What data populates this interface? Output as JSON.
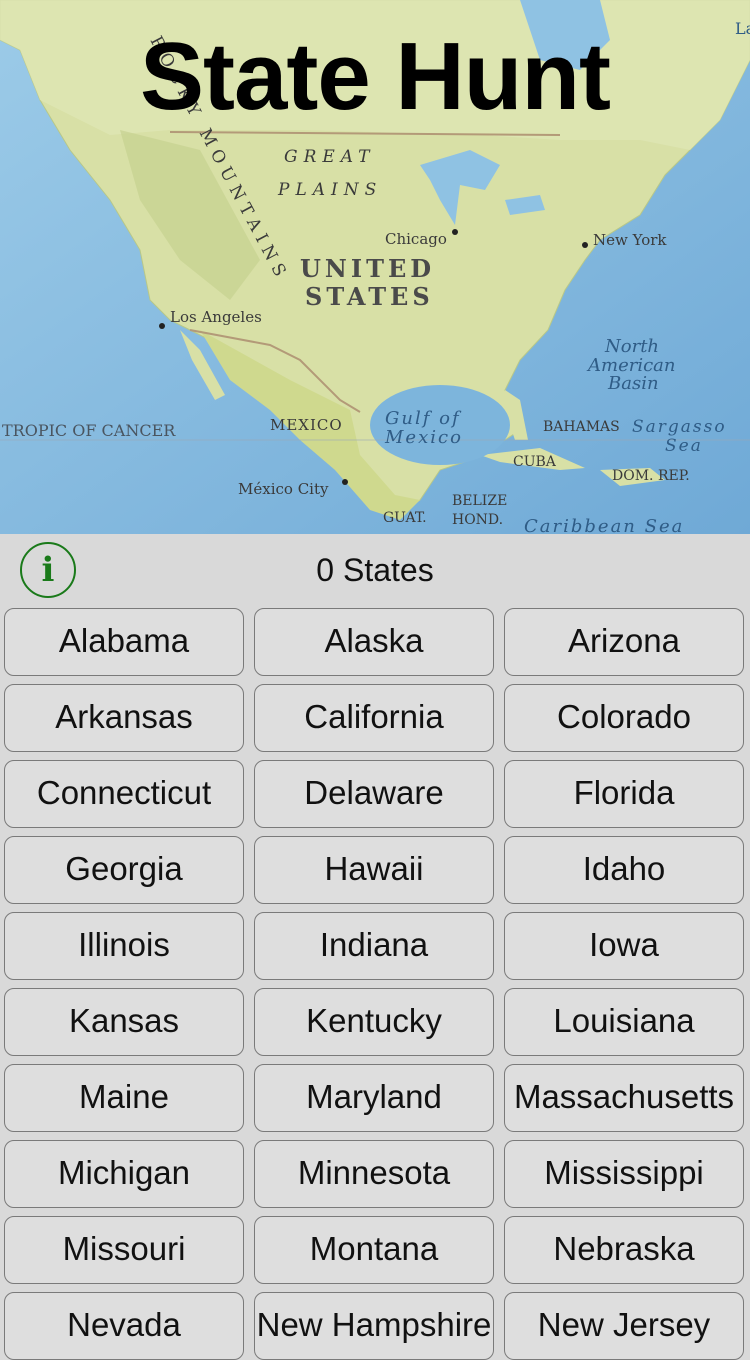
{
  "app": {
    "title": "State Hunt"
  },
  "map": {
    "labels": {
      "rocky": "ROCKY MOUNTAINS",
      "great": "GREAT",
      "plains": "PLAINS",
      "united": "UNITED",
      "states": "STATES",
      "chicago": "Chicago",
      "newyork": "New York",
      "losangeles": "Los Angeles",
      "mexico": "MEXICO",
      "mexicocity": "México City",
      "gulf1": "Gulf of",
      "gulf2": "Mexico",
      "tropic": "TROPIC OF CANCER",
      "bahamas": "BAHAMAS",
      "sargasso1": "Sargasso",
      "sargasso2": "Sea",
      "basin1": "North",
      "basin2": "American",
      "basin3": "Basin",
      "cuba": "CUBA",
      "domrep": "DOM. REP.",
      "belize": "BELIZE",
      "guat": "GUAT.",
      "hond": "HOND.",
      "caribbean": "Caribbean Sea",
      "corner": "La"
    }
  },
  "status": {
    "count_label": "0 States",
    "info_icon": "i"
  },
  "states": [
    "Alabama",
    "Alaska",
    "Arizona",
    "Arkansas",
    "California",
    "Colorado",
    "Connecticut",
    "Delaware",
    "Florida",
    "Georgia",
    "Hawaii",
    "Idaho",
    "Illinois",
    "Indiana",
    "Iowa",
    "Kansas",
    "Kentucky",
    "Louisiana",
    "Maine",
    "Maryland",
    "Massachusetts",
    "Michigan",
    "Minnesota",
    "Mississippi",
    "Missouri",
    "Montana",
    "Nebraska",
    "Nevada",
    "New Hampshire",
    "New Jersey"
  ],
  "colors": {
    "ocean": "#8fc2e3",
    "land": "#d6dfa0",
    "info_green": "#1a7a1a"
  }
}
